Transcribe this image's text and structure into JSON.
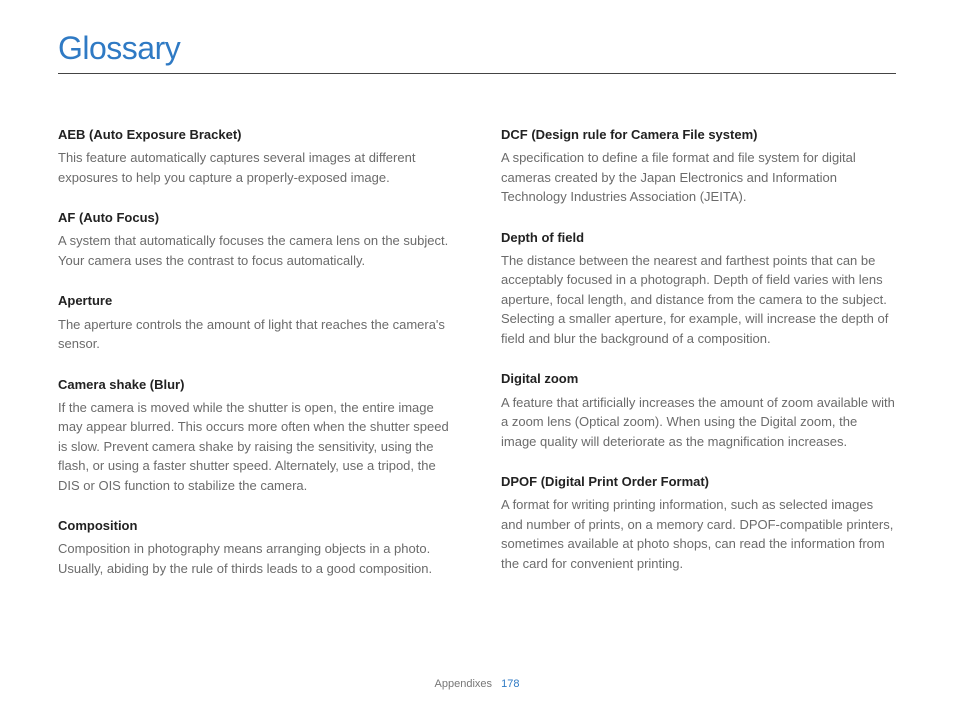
{
  "title": "Glossary",
  "footer": {
    "section": "Appendixes",
    "page": "178"
  },
  "left": [
    {
      "term": "AEB (Auto Exposure Bracket)",
      "def": "This feature automatically captures several images at different exposures to help you capture a properly-exposed image."
    },
    {
      "term": "AF (Auto Focus)",
      "def": "A system that automatically focuses the camera lens on the subject. Your camera uses the contrast to focus automatically."
    },
    {
      "term": "Aperture",
      "def": "The aperture controls the amount of light that reaches the camera's sensor."
    },
    {
      "term": "Camera shake (Blur)",
      "def": "If the camera is moved while the shutter is open, the entire image may appear blurred. This occurs more often when the shutter speed is slow. Prevent camera shake by raising the sensitivity, using the flash, or using a faster shutter speed. Alternately, use a tripod, the DIS or OIS function to stabilize the camera."
    },
    {
      "term": "Composition",
      "def": "Composition in photography means arranging objects in a photo. Usually, abiding by the rule of thirds leads to a good composition."
    }
  ],
  "right": [
    {
      "term": "DCF (Design rule for Camera File system)",
      "def": "A specification to define a file format and file system for digital cameras created by the Japan Electronics and Information Technology Industries Association (JEITA)."
    },
    {
      "term": "Depth of field",
      "def": "The distance between the nearest and farthest points that can be acceptably focused in a photograph. Depth of field varies with lens aperture, focal length, and distance from the camera to the subject. Selecting a smaller aperture, for example, will increase the depth of field and blur the background of a composition."
    },
    {
      "term": "Digital zoom",
      "def": "A feature that artificially increases the amount of zoom available with a zoom lens (Optical zoom). When using the Digital zoom, the image quality will deteriorate as the magnification increases."
    },
    {
      "term": "DPOF (Digital Print Order Format)",
      "def": "A format for writing printing information, such as selected images and number of prints, on a memory card. DPOF-compatible printers, sometimes available at photo shops, can read the information from the card for convenient printing."
    }
  ]
}
